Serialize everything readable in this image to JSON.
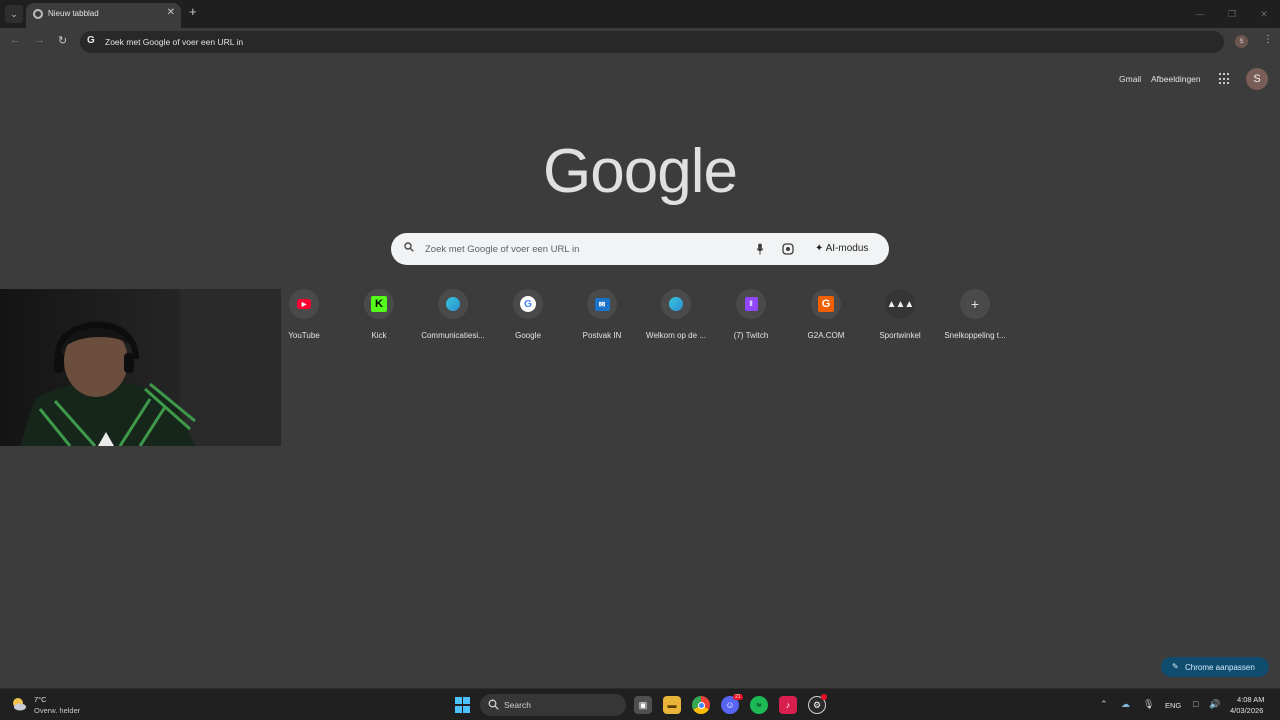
{
  "browser": {
    "tab_title": "Nieuw tabblad",
    "omnibox_text": "Zoek met Google of voer een URL in",
    "profile_initial_small": "S"
  },
  "ntp": {
    "links": {
      "gmail": "Gmail",
      "images": "Afbeeldingen"
    },
    "avatar_initial": "S",
    "logo": "Google",
    "search": {
      "placeholder": "Zoek met Google of voer een URL in",
      "ai_mode": "AI-modus"
    },
    "shortcuts": [
      {
        "label": "YouTube",
        "icon": "youtube-icon"
      },
      {
        "label": "Kick",
        "icon": "kick-icon"
      },
      {
        "label": "Communicatiesi...",
        "icon": "edge-icon"
      },
      {
        "label": "Google",
        "icon": "google-icon"
      },
      {
        "label": "Postvak IN",
        "icon": "outlook-icon"
      },
      {
        "label": "Welkom op de ...",
        "icon": "edge-icon"
      },
      {
        "label": "(7) Twitch",
        "icon": "twitch-icon"
      },
      {
        "label": "G2A.COM",
        "icon": "g2a-icon"
      },
      {
        "label": "Sportwinkel",
        "icon": "adidas-icon"
      },
      {
        "label": "Snelkoppeling t...",
        "icon": "plus-icon"
      }
    ],
    "customize_label": "Chrome aanpassen"
  },
  "taskbar": {
    "weather": {
      "temp": "7°C",
      "desc": "Overw. helder"
    },
    "search_label": "Search",
    "discord_badge": "21",
    "lang": "ENG",
    "time": "4:08 AM",
    "date": "4/03/2026"
  },
  "colors": {
    "page_bg": "#3c3c3c",
    "customize_bg": "#0f4c6e",
    "start_blue": "#4cc2ff"
  }
}
